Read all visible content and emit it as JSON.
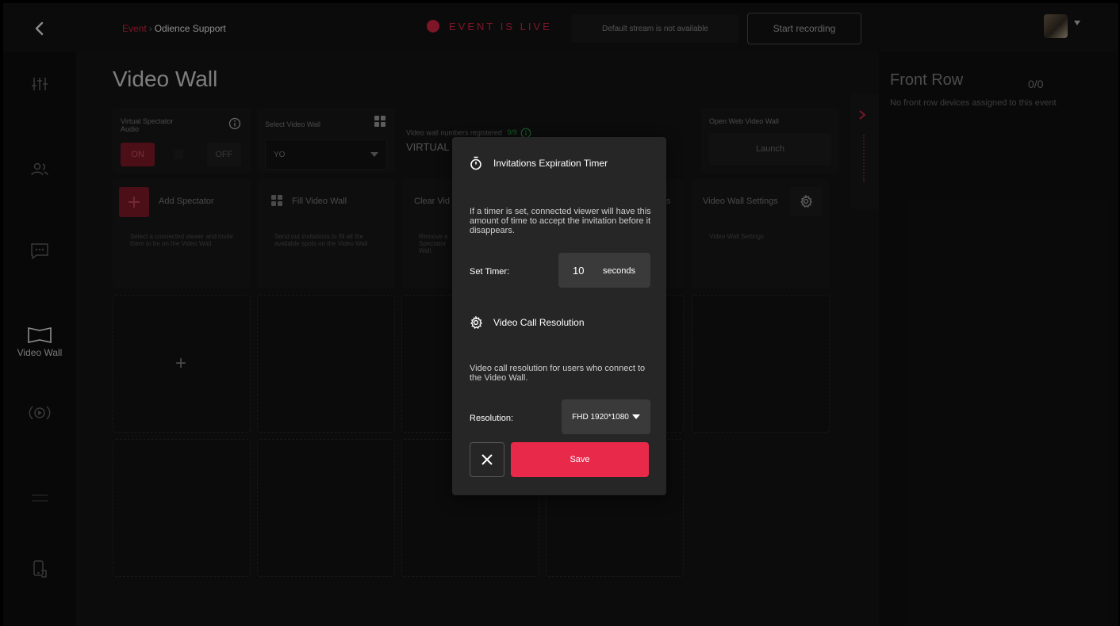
{
  "header": {
    "breadcrumb_event": "Event",
    "breadcrumb_separator": "›",
    "breadcrumb_current": "Odience Support",
    "live_text": "EVENT IS LIVE",
    "stream_status": "Default stream is not available",
    "record_label": "Start recording"
  },
  "nav": {
    "video_wall_label": "Video Wall"
  },
  "main": {
    "title": "Video Wall",
    "audio_label": "Virtual Spectator Audio",
    "audio_on": "ON",
    "audio_off": "OFF",
    "select_wall_label": "Select Video Wall",
    "select_wall_value": "YO",
    "registered_label": "Video wall numbers registered",
    "registered_count": "9/9",
    "virtual_label": "VIRTUAL",
    "web_wall_label": "Open Web Video Wall",
    "launch_label": "Launch",
    "actions": {
      "add_title": "Add Spectator",
      "add_desc": "Select a connected viewer and invite them to be on the Video Wall",
      "fill_title": "Fill Video Wall",
      "fill_desc": "Send out invitations to fill all the available spots on the Video Wall",
      "clear_title": "Clear Vid",
      "clear_desc": "Remove a Spectator Wall",
      "settings_title": "Video Wall Settings",
      "settings_desc": "Video Wall Settings"
    },
    "slot_add": "+"
  },
  "right_panel": {
    "title": "Front Row",
    "count": "0/0",
    "description": "No front row devices assigned to this event"
  },
  "modal": {
    "timer_heading": "Invitations Expiration Timer",
    "timer_desc": "If a timer is set, connected viewer will have this amount of time to accept the invitation before it disappears.",
    "set_timer_label": "Set Timer:",
    "timer_value": "10",
    "timer_unit": "seconds",
    "resolution_heading": "Video Call Resolution",
    "resolution_desc": "Video call resolution for users who connect to the Video Wall.",
    "resolution_label": "Resolution:",
    "resolution_value": "FHD 1920*1080",
    "save_label": "Save"
  },
  "colors": {
    "accent": "#e8294a",
    "success": "#2fa44f",
    "background": "#161616",
    "modal": "#262626"
  }
}
